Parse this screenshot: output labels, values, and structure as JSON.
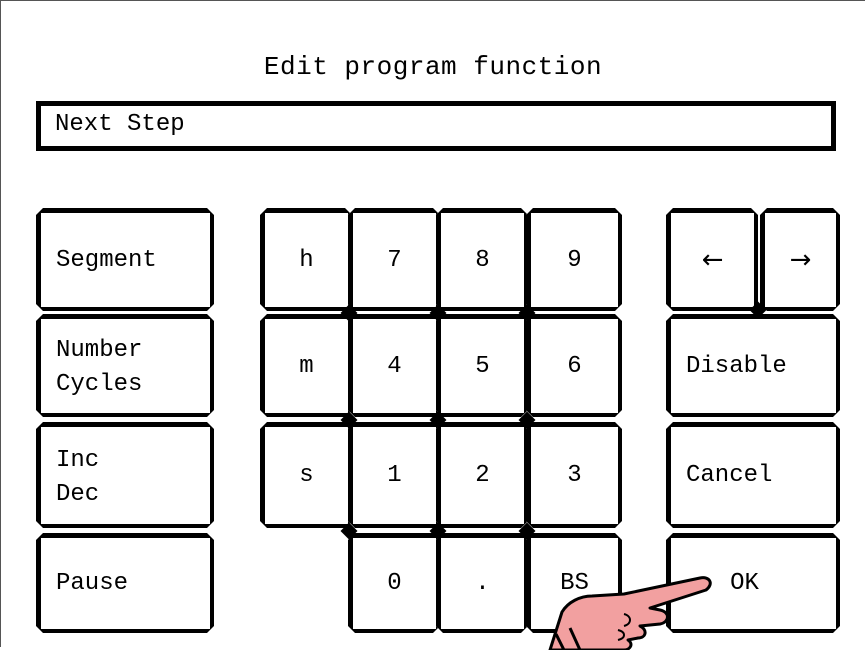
{
  "dialog": {
    "title": "Edit program function",
    "field_value": "Next Step"
  },
  "function_keys": {
    "segment": "Segment",
    "number_cycles_line1": "Number",
    "number_cycles_line2": "Cycles",
    "inc_dec_line1": "Inc",
    "inc_dec_line2": "Dec",
    "pause": "Pause"
  },
  "unit_keys": {
    "h": "h",
    "m": "m",
    "s": "s"
  },
  "numpad": {
    "k7": "7",
    "k8": "8",
    "k9": "9",
    "k4": "4",
    "k5": "5",
    "k6": "6",
    "k1": "1",
    "k2": "2",
    "k3": "3",
    "k0": "0",
    "dot": ".",
    "bs": "BS"
  },
  "control_keys": {
    "left": "←",
    "right": "→",
    "disable": "Disable",
    "cancel": "Cancel",
    "ok": "OK"
  },
  "colors": {
    "hand_fill": "#f2a0a0",
    "outline": "#000000"
  }
}
